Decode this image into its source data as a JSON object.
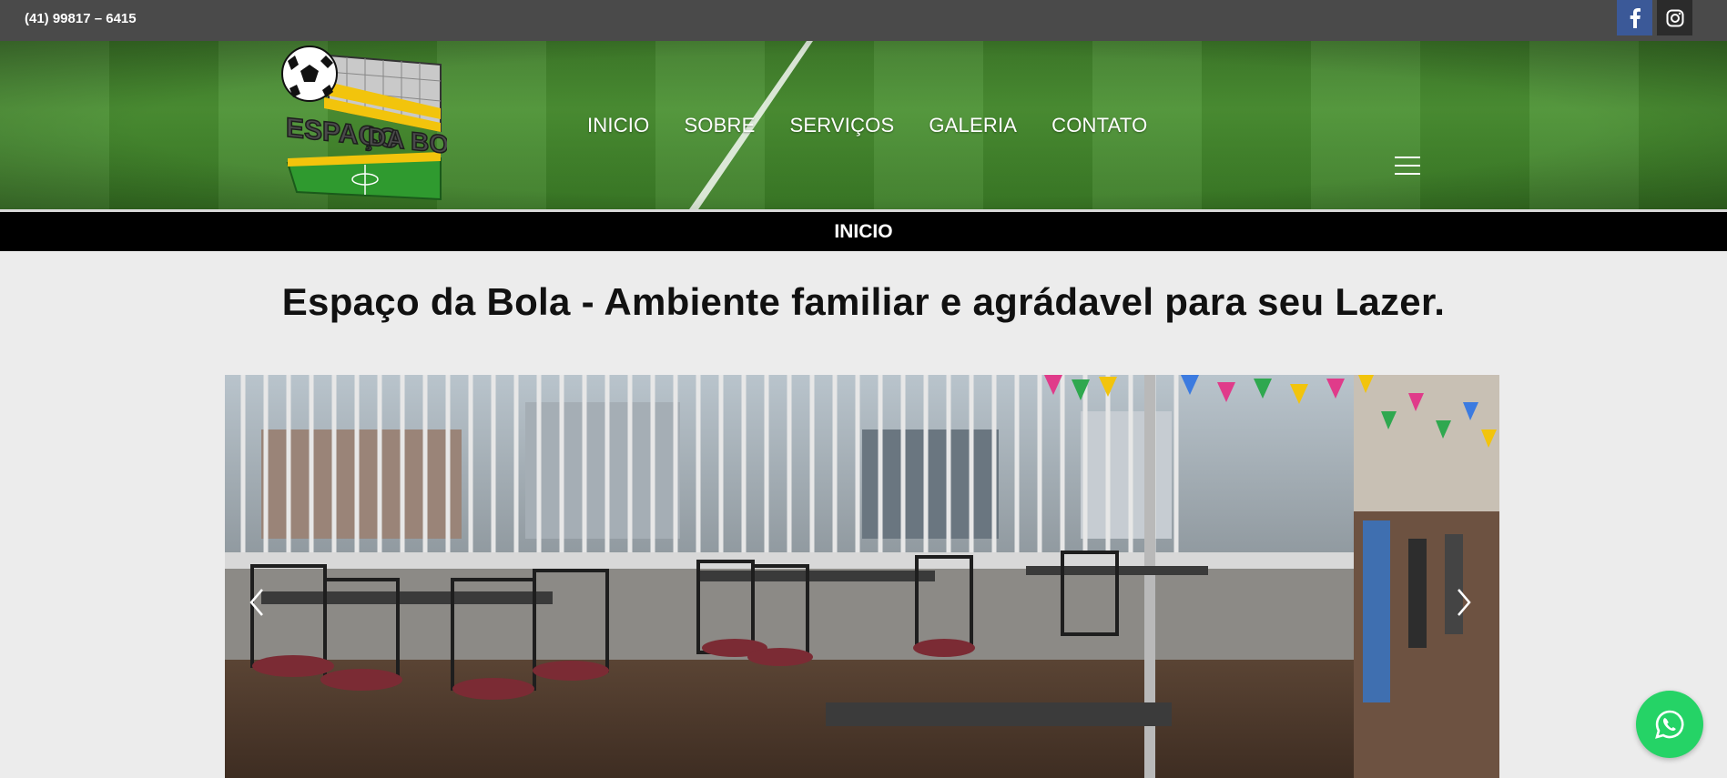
{
  "topbar": {
    "phone": "(41) 99817 – 6415",
    "social": [
      {
        "name": "facebook-icon",
        "color": "#3b5998"
      },
      {
        "name": "instagram-icon",
        "color": "#2b2b2b"
      }
    ]
  },
  "header": {
    "logo_text_line1": "ESPAÇO",
    "logo_text_line2": "DA BOLA",
    "nav": [
      {
        "label": "INICIO"
      },
      {
        "label": "SOBRE"
      },
      {
        "label": "SERVIÇOS"
      },
      {
        "label": "GALERIA"
      },
      {
        "label": "CONTATO"
      }
    ],
    "menu_icon": "hamburger-icon"
  },
  "pagebar": {
    "title": "INICIO"
  },
  "main": {
    "headline": "Espaço da Bola - Ambiente familiar e agrádavel para seu Lazer.",
    "carousel": {
      "prev_icon": "chevron-left-icon",
      "next_icon": "chevron-right-icon"
    }
  },
  "floating": {
    "whatsapp_icon": "whatsapp-icon",
    "color": "#25d366"
  }
}
